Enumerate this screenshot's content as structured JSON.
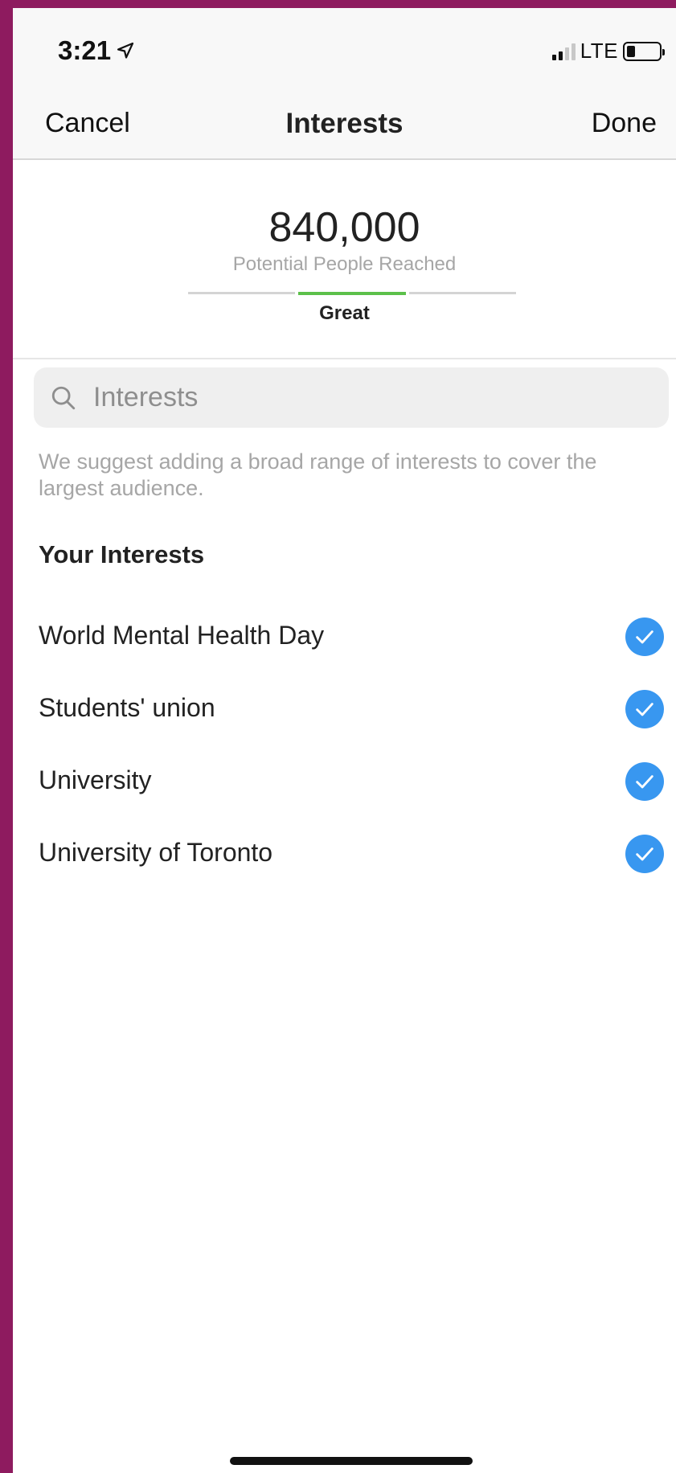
{
  "status_bar": {
    "time": "3:21",
    "network": "LTE",
    "icons": [
      "location-arrow-icon",
      "signal-icon",
      "battery-icon"
    ]
  },
  "nav": {
    "cancel_label": "Cancel",
    "title": "Interests",
    "done_label": "Done"
  },
  "reach": {
    "count": "840,000",
    "label": "Potential People Reached",
    "rating": "Great",
    "rating_color": "#5cc04a"
  },
  "search": {
    "placeholder": "Interests",
    "value": "",
    "icon": "search-icon"
  },
  "hint": "We suggest adding a broad range of interests to cover the largest audience.",
  "your_interests": {
    "title": "Your Interests",
    "items": [
      {
        "label": "World Mental Health Day",
        "selected": true
      },
      {
        "label": "Students' union",
        "selected": true
      },
      {
        "label": "University",
        "selected": true
      },
      {
        "label": "University of Toronto",
        "selected": true
      }
    ]
  },
  "colors": {
    "accent": "#3897f0",
    "frame": "#8e1b5f"
  }
}
